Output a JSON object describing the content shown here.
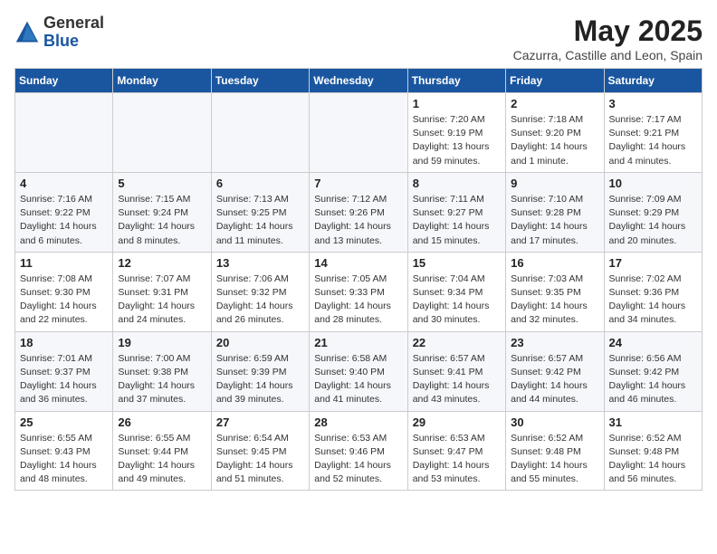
{
  "header": {
    "logo_line1": "General",
    "logo_line2": "Blue",
    "main_title": "May 2025",
    "subtitle": "Cazurra, Castille and Leon, Spain"
  },
  "weekdays": [
    "Sunday",
    "Monday",
    "Tuesday",
    "Wednesday",
    "Thursday",
    "Friday",
    "Saturday"
  ],
  "weeks": [
    [
      {
        "day": "",
        "sunrise": "",
        "sunset": "",
        "daylight": ""
      },
      {
        "day": "",
        "sunrise": "",
        "sunset": "",
        "daylight": ""
      },
      {
        "day": "",
        "sunrise": "",
        "sunset": "",
        "daylight": ""
      },
      {
        "day": "",
        "sunrise": "",
        "sunset": "",
        "daylight": ""
      },
      {
        "day": "1",
        "sunrise": "Sunrise: 7:20 AM",
        "sunset": "Sunset: 9:19 PM",
        "daylight": "Daylight: 13 hours and 59 minutes."
      },
      {
        "day": "2",
        "sunrise": "Sunrise: 7:18 AM",
        "sunset": "Sunset: 9:20 PM",
        "daylight": "Daylight: 14 hours and 1 minute."
      },
      {
        "day": "3",
        "sunrise": "Sunrise: 7:17 AM",
        "sunset": "Sunset: 9:21 PM",
        "daylight": "Daylight: 14 hours and 4 minutes."
      }
    ],
    [
      {
        "day": "4",
        "sunrise": "Sunrise: 7:16 AM",
        "sunset": "Sunset: 9:22 PM",
        "daylight": "Daylight: 14 hours and 6 minutes."
      },
      {
        "day": "5",
        "sunrise": "Sunrise: 7:15 AM",
        "sunset": "Sunset: 9:24 PM",
        "daylight": "Daylight: 14 hours and 8 minutes."
      },
      {
        "day": "6",
        "sunrise": "Sunrise: 7:13 AM",
        "sunset": "Sunset: 9:25 PM",
        "daylight": "Daylight: 14 hours and 11 minutes."
      },
      {
        "day": "7",
        "sunrise": "Sunrise: 7:12 AM",
        "sunset": "Sunset: 9:26 PM",
        "daylight": "Daylight: 14 hours and 13 minutes."
      },
      {
        "day": "8",
        "sunrise": "Sunrise: 7:11 AM",
        "sunset": "Sunset: 9:27 PM",
        "daylight": "Daylight: 14 hours and 15 minutes."
      },
      {
        "day": "9",
        "sunrise": "Sunrise: 7:10 AM",
        "sunset": "Sunset: 9:28 PM",
        "daylight": "Daylight: 14 hours and 17 minutes."
      },
      {
        "day": "10",
        "sunrise": "Sunrise: 7:09 AM",
        "sunset": "Sunset: 9:29 PM",
        "daylight": "Daylight: 14 hours and 20 minutes."
      }
    ],
    [
      {
        "day": "11",
        "sunrise": "Sunrise: 7:08 AM",
        "sunset": "Sunset: 9:30 PM",
        "daylight": "Daylight: 14 hours and 22 minutes."
      },
      {
        "day": "12",
        "sunrise": "Sunrise: 7:07 AM",
        "sunset": "Sunset: 9:31 PM",
        "daylight": "Daylight: 14 hours and 24 minutes."
      },
      {
        "day": "13",
        "sunrise": "Sunrise: 7:06 AM",
        "sunset": "Sunset: 9:32 PM",
        "daylight": "Daylight: 14 hours and 26 minutes."
      },
      {
        "day": "14",
        "sunrise": "Sunrise: 7:05 AM",
        "sunset": "Sunset: 9:33 PM",
        "daylight": "Daylight: 14 hours and 28 minutes."
      },
      {
        "day": "15",
        "sunrise": "Sunrise: 7:04 AM",
        "sunset": "Sunset: 9:34 PM",
        "daylight": "Daylight: 14 hours and 30 minutes."
      },
      {
        "day": "16",
        "sunrise": "Sunrise: 7:03 AM",
        "sunset": "Sunset: 9:35 PM",
        "daylight": "Daylight: 14 hours and 32 minutes."
      },
      {
        "day": "17",
        "sunrise": "Sunrise: 7:02 AM",
        "sunset": "Sunset: 9:36 PM",
        "daylight": "Daylight: 14 hours and 34 minutes."
      }
    ],
    [
      {
        "day": "18",
        "sunrise": "Sunrise: 7:01 AM",
        "sunset": "Sunset: 9:37 PM",
        "daylight": "Daylight: 14 hours and 36 minutes."
      },
      {
        "day": "19",
        "sunrise": "Sunrise: 7:00 AM",
        "sunset": "Sunset: 9:38 PM",
        "daylight": "Daylight: 14 hours and 37 minutes."
      },
      {
        "day": "20",
        "sunrise": "Sunrise: 6:59 AM",
        "sunset": "Sunset: 9:39 PM",
        "daylight": "Daylight: 14 hours and 39 minutes."
      },
      {
        "day": "21",
        "sunrise": "Sunrise: 6:58 AM",
        "sunset": "Sunset: 9:40 PM",
        "daylight": "Daylight: 14 hours and 41 minutes."
      },
      {
        "day": "22",
        "sunrise": "Sunrise: 6:57 AM",
        "sunset": "Sunset: 9:41 PM",
        "daylight": "Daylight: 14 hours and 43 minutes."
      },
      {
        "day": "23",
        "sunrise": "Sunrise: 6:57 AM",
        "sunset": "Sunset: 9:42 PM",
        "daylight": "Daylight: 14 hours and 44 minutes."
      },
      {
        "day": "24",
        "sunrise": "Sunrise: 6:56 AM",
        "sunset": "Sunset: 9:42 PM",
        "daylight": "Daylight: 14 hours and 46 minutes."
      }
    ],
    [
      {
        "day": "25",
        "sunrise": "Sunrise: 6:55 AM",
        "sunset": "Sunset: 9:43 PM",
        "daylight": "Daylight: 14 hours and 48 minutes."
      },
      {
        "day": "26",
        "sunrise": "Sunrise: 6:55 AM",
        "sunset": "Sunset: 9:44 PM",
        "daylight": "Daylight: 14 hours and 49 minutes."
      },
      {
        "day": "27",
        "sunrise": "Sunrise: 6:54 AM",
        "sunset": "Sunset: 9:45 PM",
        "daylight": "Daylight: 14 hours and 51 minutes."
      },
      {
        "day": "28",
        "sunrise": "Sunrise: 6:53 AM",
        "sunset": "Sunset: 9:46 PM",
        "daylight": "Daylight: 14 hours and 52 minutes."
      },
      {
        "day": "29",
        "sunrise": "Sunrise: 6:53 AM",
        "sunset": "Sunset: 9:47 PM",
        "daylight": "Daylight: 14 hours and 53 minutes."
      },
      {
        "day": "30",
        "sunrise": "Sunrise: 6:52 AM",
        "sunset": "Sunset: 9:48 PM",
        "daylight": "Daylight: 14 hours and 55 minutes."
      },
      {
        "day": "31",
        "sunrise": "Sunrise: 6:52 AM",
        "sunset": "Sunset: 9:48 PM",
        "daylight": "Daylight: 14 hours and 56 minutes."
      }
    ]
  ]
}
